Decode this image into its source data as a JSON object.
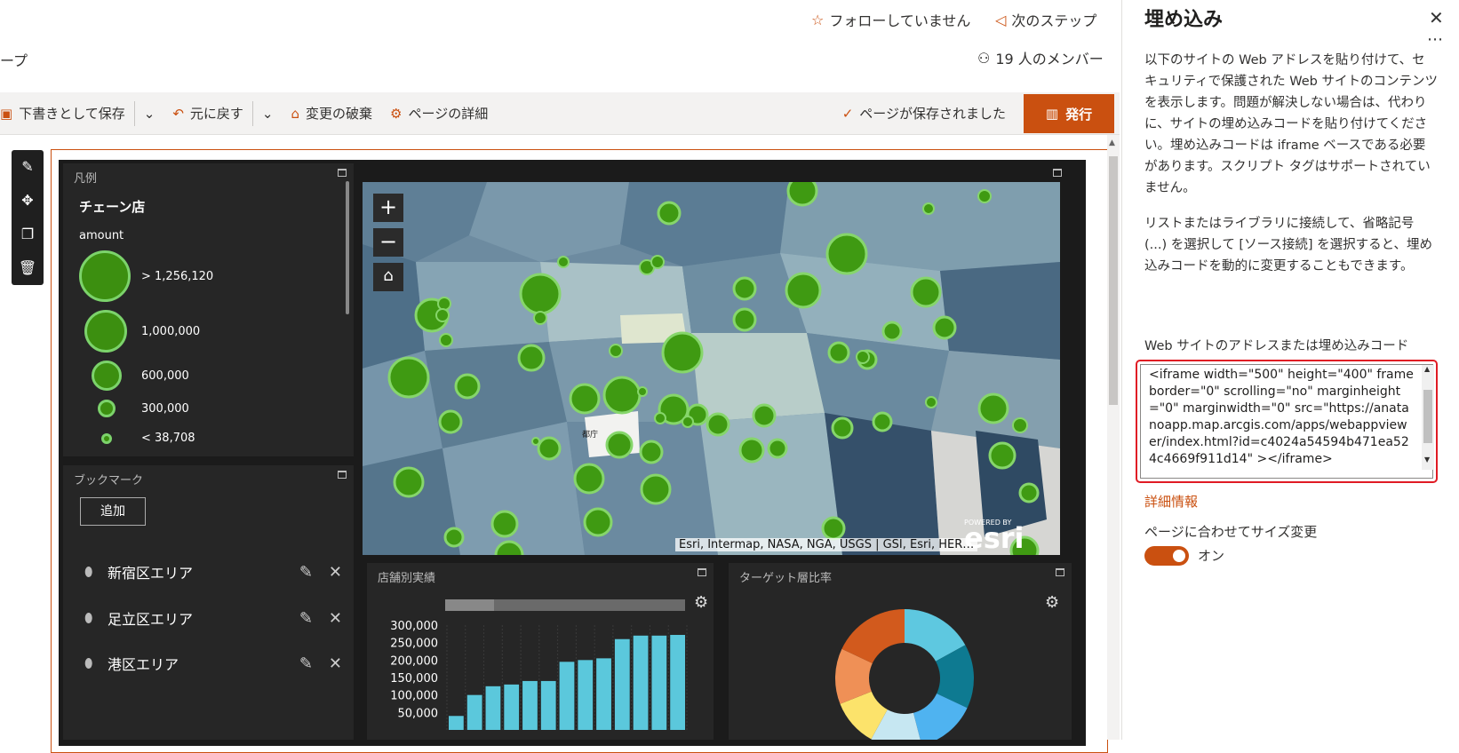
{
  "header": {
    "breadcrumb_fragment": "ープ",
    "follow_label": "フォローしていません",
    "next_steps_label": "次のステップ",
    "members_label": "19 人のメンバー"
  },
  "commandbar": {
    "save_draft": "下書きとして保存",
    "undo": "元に戻す",
    "discard": "変更の破棄",
    "page_details": "ページの詳細",
    "saved_status": "ページが保存されました",
    "publish": "発行"
  },
  "legend": {
    "title": "凡例",
    "layer_name": "チェーン店",
    "field_name": "amount",
    "classes": [
      "> 1,256,120",
      "1,000,000",
      "600,000",
      "300,000",
      "< 38,708"
    ]
  },
  "bookmarks": {
    "title": "ブックマーク",
    "add_button": "追加",
    "items": [
      "新宿区エリア",
      "足立区エリア",
      "港区エリア"
    ]
  },
  "map": {
    "attribution": "Esri, Intermap, NASA, NGA, USGS | GSI, Esri, HER…",
    "logo_text": "esri",
    "logo_caption": "POWERED BY",
    "label_tocho": "都庁"
  },
  "bar_panel": {
    "title": "店舗別実績",
    "y_ticks": [
      "300,000",
      "250,000",
      "200,000",
      "150,000",
      "100,000",
      "50,000"
    ]
  },
  "donut_panel": {
    "title": "ターゲット層比率"
  },
  "chart_data": [
    {
      "type": "bar",
      "title": "店舗別実績",
      "categories": [],
      "values": [
        40000,
        100000,
        125000,
        130000,
        140000,
        140000,
        195000,
        200000,
        205000,
        260000,
        270000,
        270000,
        272000
      ],
      "ylim": [
        0,
        300000
      ],
      "color": "#5bc8dc"
    },
    {
      "type": "pie",
      "title": "ターゲット層比率",
      "values": [
        17,
        15,
        14,
        12,
        11,
        13,
        18
      ],
      "colors": [
        "#5ec8e0",
        "#0e7a91",
        "#4fb3f0",
        "#c6e7f2",
        "#fce36b",
        "#ef9056",
        "#d25a1d"
      ]
    }
  ],
  "settings_panel": {
    "title": "埋め込み",
    "description1": "以下のサイトの Web アドレスを貼り付けて、セキュリティで保護された Web サイトのコンテンツを表示します。問題が解決しない場合は、代わりに、サイトの埋め込みコードを貼り付けてください。埋め込みコードは iframe ベースである必要があります。スクリプト タグはサポートされていません。",
    "description2": "リストまたはライブラリに接続して、省略記号 (...) を選択して [ソース接続] を選択すると、埋め込みコードを動的に変更することもできます。",
    "field_label": "Web サイトのアドレスまたは埋め込みコード",
    "embed_code": "<iframe width=\"500\" height=\"400\" frameborder=\"0\" scrolling=\"no\" marginheight=\"0\" marginwidth=\"0\" src=\"https://anatanoapp.map.arcgis.com/apps/webappviewer/index.html?id=c4024a54594b471ea524c4669f911d14\" ></iframe>",
    "more_info": "詳細情報",
    "resize_label": "ページに合わせてサイズ変更",
    "toggle_state": "オン"
  },
  "colors": {
    "accent": "#ca5010",
    "highlight": "#e01b24"
  }
}
